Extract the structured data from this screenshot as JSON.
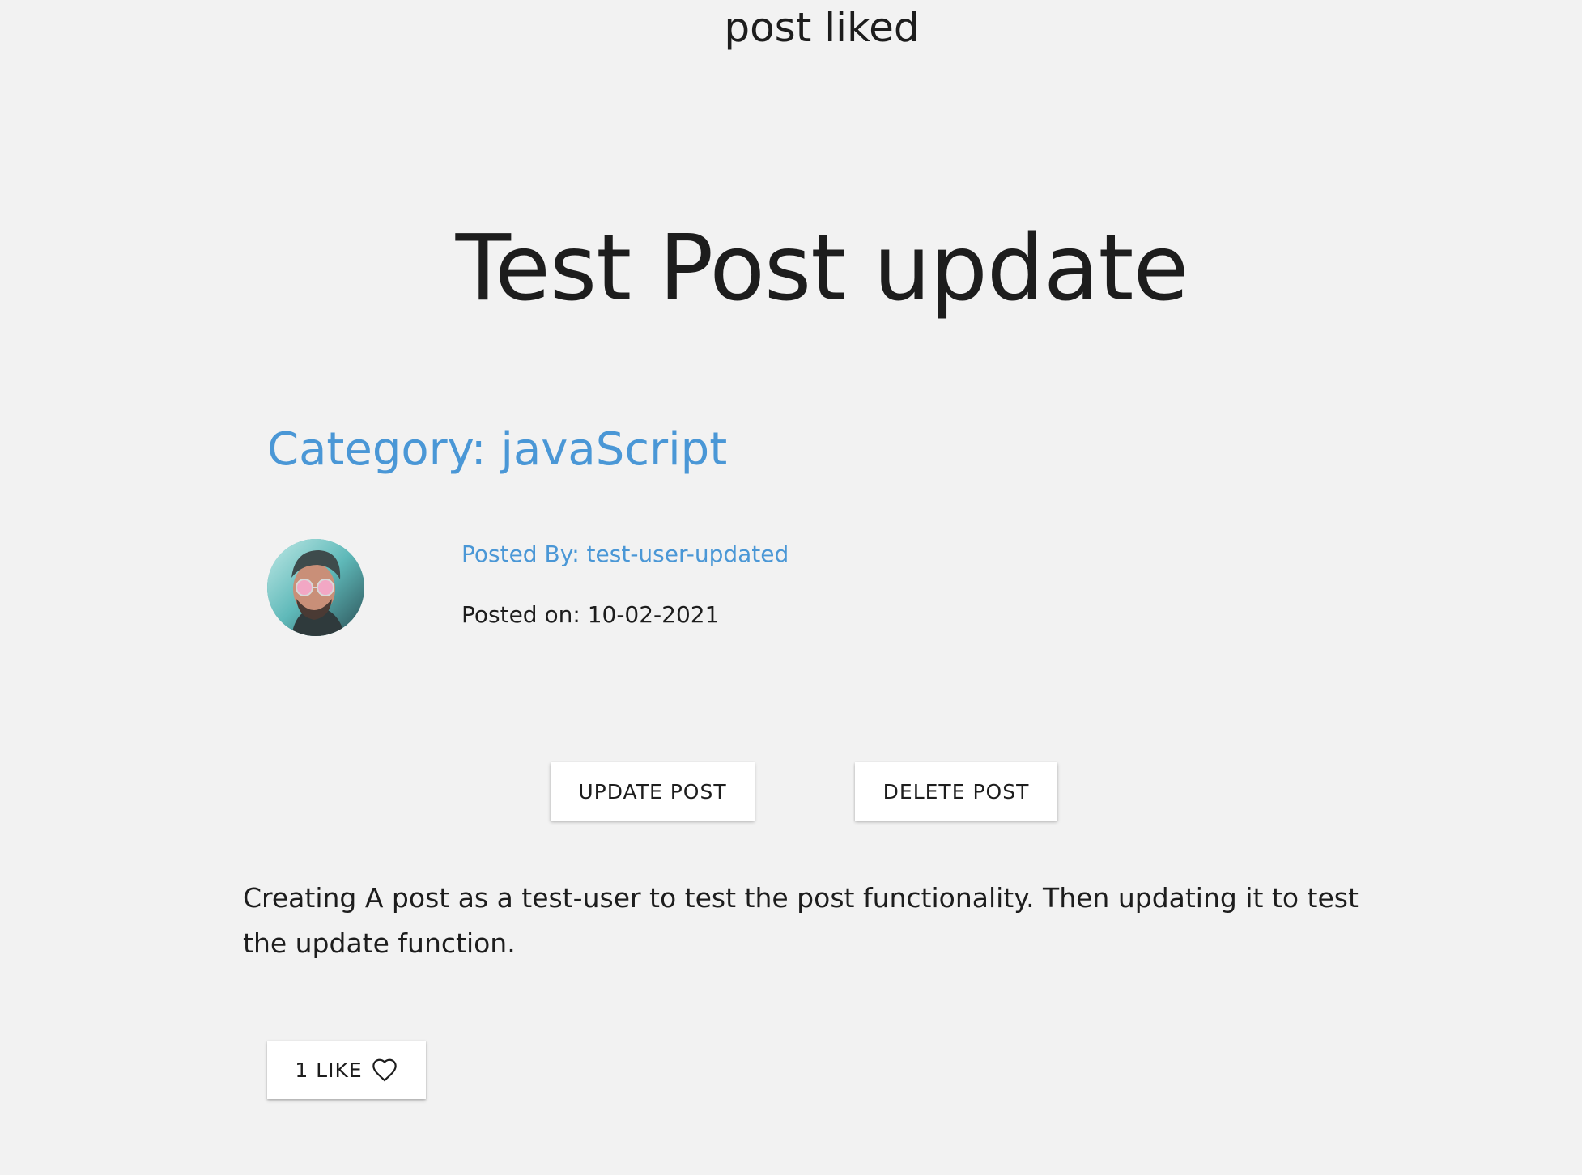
{
  "toast": {
    "message": "post liked"
  },
  "post": {
    "title": "Test Post update",
    "category": "Category: javaScript",
    "posted_by": "Posted By: test-user-updated",
    "posted_on": "Posted on: 10-02-2021",
    "content": "Creating A post as a test-user to test the post functionality. Then updating it to test the update function."
  },
  "actions": {
    "update_label": "UPDATE POST",
    "delete_label": "DELETE POST"
  },
  "likes": {
    "count": "1",
    "label": "LIKE",
    "icon": "heart-outline-icon"
  },
  "colors": {
    "accent": "#4a97d6",
    "background": "#f2f2f2",
    "text": "#1d1d1d"
  }
}
